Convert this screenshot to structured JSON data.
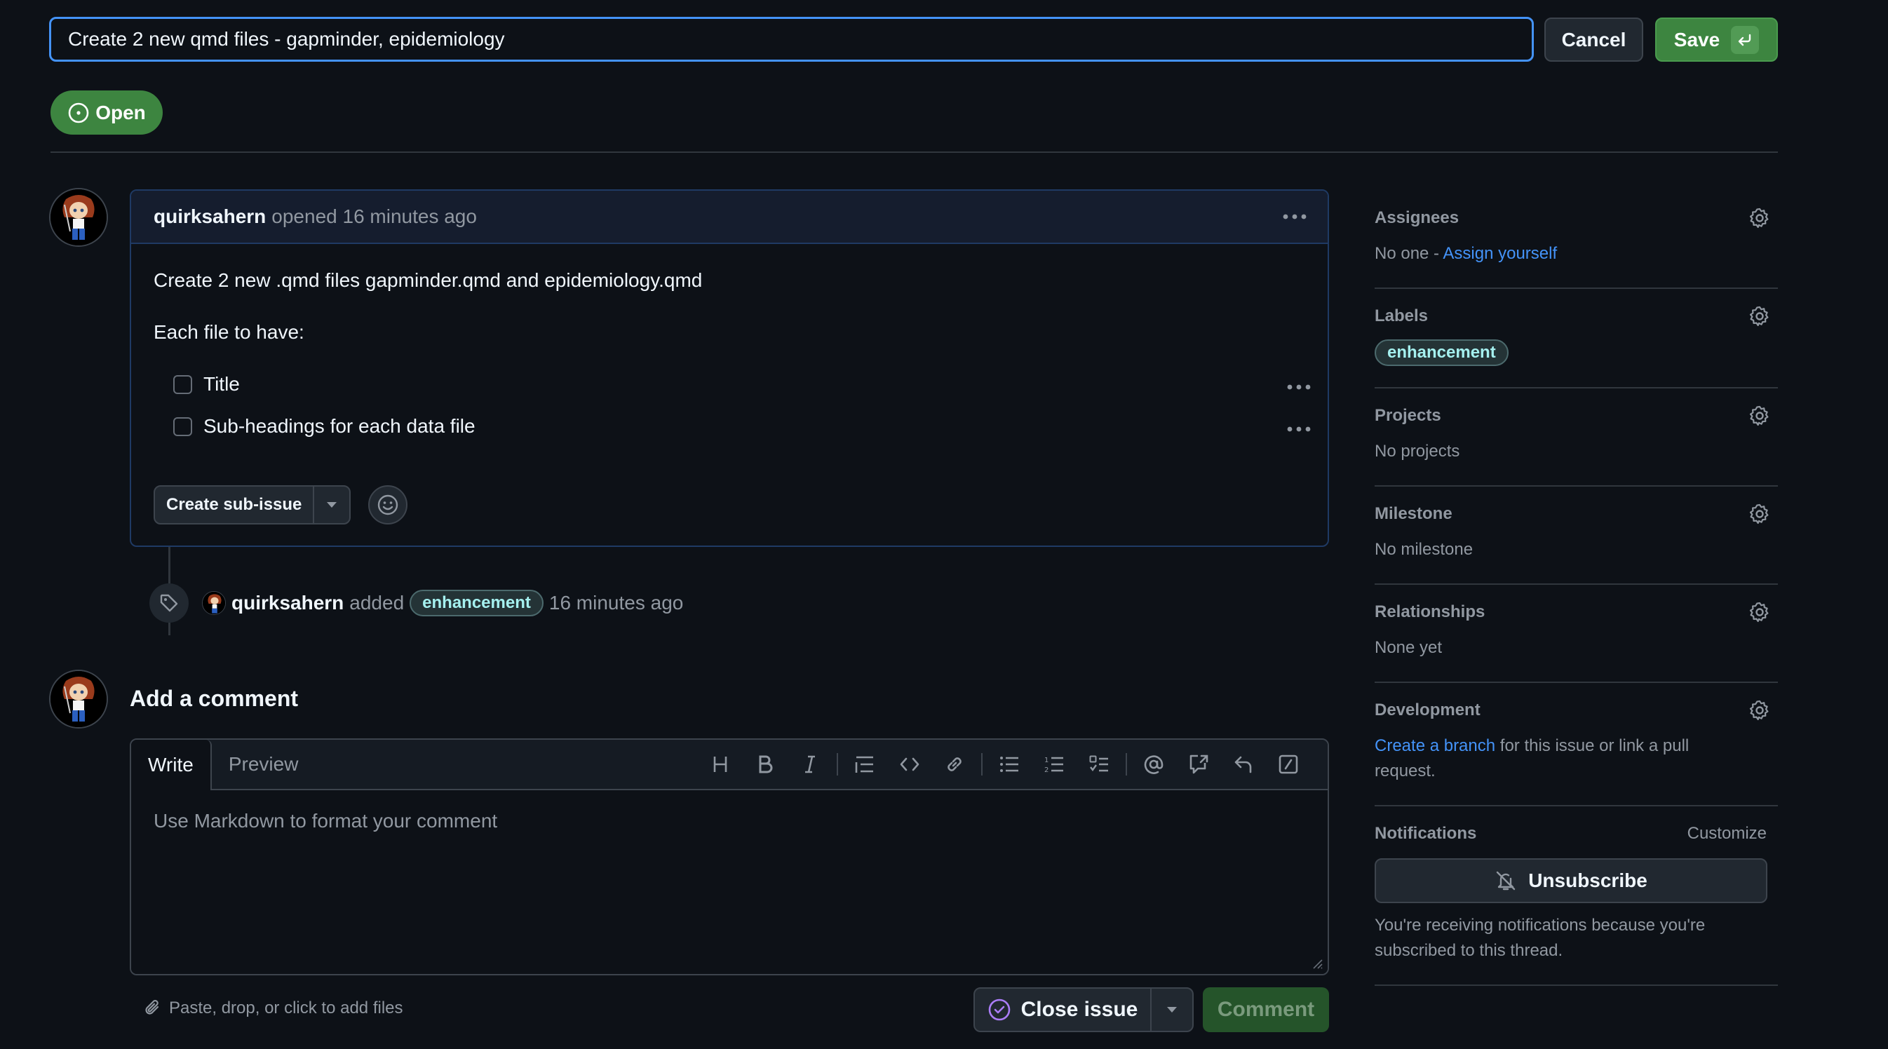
{
  "title_edit": {
    "value": "Create 2 new qmd files - gapminder, epidemiology",
    "cancel_label": "Cancel",
    "save_label": "Save",
    "save_shortcut_icon": "enter-key-icon"
  },
  "state_badge": {
    "label": "Open",
    "icon": "issue-opened-icon",
    "color": "#3d8540"
  },
  "issue": {
    "author": "quirksahern",
    "opened_text": "opened 16 minutes ago",
    "body_line_1": "Create 2 new .qmd files gapminder.qmd and epidemiology.qmd",
    "body_line_2": "Each file to have:",
    "tasks": [
      {
        "label": "Title",
        "checked": false
      },
      {
        "label": "Sub-headings for each data file",
        "checked": false
      }
    ],
    "create_sub_issue_label": "Create sub-issue"
  },
  "timeline_event": {
    "actor": "quirksahern",
    "action": "added",
    "label": "enhancement",
    "time": "16 minutes ago"
  },
  "composer": {
    "heading": "Add a comment",
    "tabs": [
      "Write",
      "Preview"
    ],
    "active_tab": "Write",
    "placeholder": "Use Markdown to format your comment",
    "value": "",
    "toolbar_icons": [
      "heading-icon",
      "bold-icon",
      "italic-icon",
      "quote-icon",
      "code-icon",
      "link-icon",
      "unordered-list-icon",
      "ordered-list-icon",
      "task-list-icon",
      "mention-icon",
      "cross-reference-icon",
      "saved-reply-icon",
      "slash-command-icon"
    ],
    "attach_text": "Paste, drop, or click to add files",
    "close_issue_label": "Close issue",
    "comment_label": "Comment"
  },
  "sidebar": {
    "assignees": {
      "heading": "Assignees",
      "value_prefix": "No one - ",
      "link": "Assign yourself"
    },
    "labels": {
      "heading": "Labels",
      "items": [
        "enhancement"
      ]
    },
    "projects": {
      "heading": "Projects",
      "value": "No projects"
    },
    "milestone": {
      "heading": "Milestone",
      "value": "No milestone"
    },
    "relationships": {
      "heading": "Relationships",
      "value": "None yet"
    },
    "development": {
      "heading": "Development",
      "link": "Create a branch",
      "value_suffix": " for this issue or link a pull request."
    },
    "notifications": {
      "heading": "Notifications",
      "customize": "Customize",
      "button": "Unsubscribe",
      "note": "You're receiving notifications because you're subscribed to this thread."
    }
  },
  "colors": {
    "background": "#0d1117",
    "accent_blue": "#4493f8",
    "success_green": "#3d8540",
    "label_enhancement_text": "#a5f0ef",
    "close_issue_purple": "#ab7df8"
  }
}
